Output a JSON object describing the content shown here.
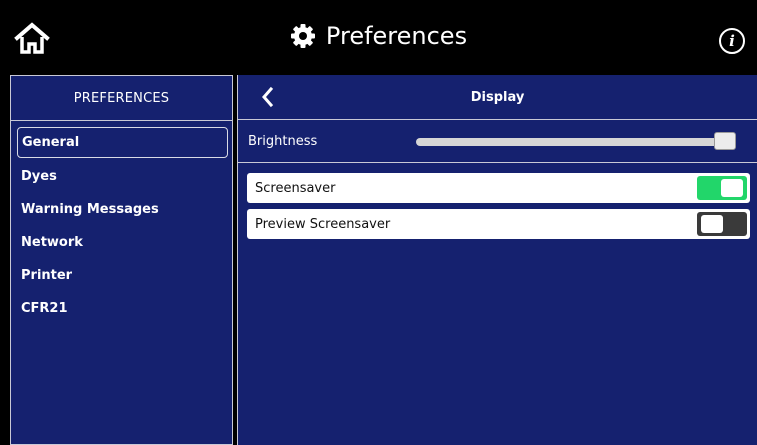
{
  "header": {
    "title": "Preferences",
    "home_icon": "home-icon",
    "settings_icon": "gear-icon",
    "info_icon": "info-icon",
    "info_glyph": "i"
  },
  "sidebar": {
    "header": "PREFERENCES",
    "items": [
      {
        "label": "General",
        "active": true
      },
      {
        "label": "Dyes",
        "active": false
      },
      {
        "label": "Warning Messages",
        "active": false
      },
      {
        "label": "Network",
        "active": false
      },
      {
        "label": "Printer",
        "active": false
      },
      {
        "label": "CFR21",
        "active": false
      }
    ]
  },
  "main": {
    "title": "Display",
    "brightness": {
      "label": "Brightness",
      "value_percent": 100
    },
    "toggles": [
      {
        "label": "Screensaver",
        "on": true
      },
      {
        "label": "Preview Screensaver",
        "on": false
      }
    ]
  },
  "colors": {
    "background": "#000000",
    "panel": "#15216f",
    "toggle_on": "#22d66a",
    "toggle_off": "#3a3a3a"
  }
}
